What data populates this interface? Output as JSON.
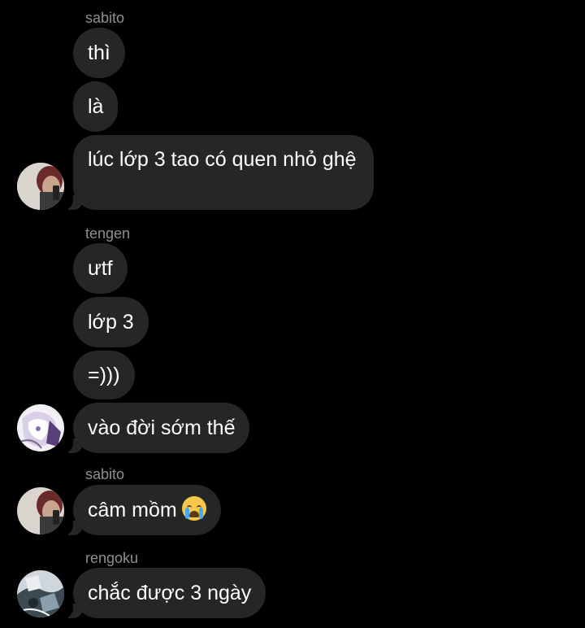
{
  "groups": [
    {
      "sender": "sabito",
      "avatar_icon": "sabito-avatar",
      "messages": [
        "thì",
        "là",
        "lúc lớp 3 tao có quen nhỏ ghệ"
      ]
    },
    {
      "sender": "tengen",
      "avatar_icon": "tengen-avatar",
      "messages": [
        "ưtf",
        "lớp 3",
        "=)))",
        "vào đời sớm thế"
      ]
    },
    {
      "sender": "sabito",
      "avatar_icon": "sabito-avatar",
      "messages": [
        "câm mồm"
      ],
      "emoji": "loudly-crying-face-emoji"
    },
    {
      "sender": "rengoku",
      "avatar_icon": "rengoku-avatar",
      "messages": [
        "chắc được 3 ngày"
      ]
    }
  ],
  "colors": {
    "background": "#000000",
    "bubble": "#262626",
    "text": "#ffffff",
    "sender_name": "#8e8e93"
  }
}
